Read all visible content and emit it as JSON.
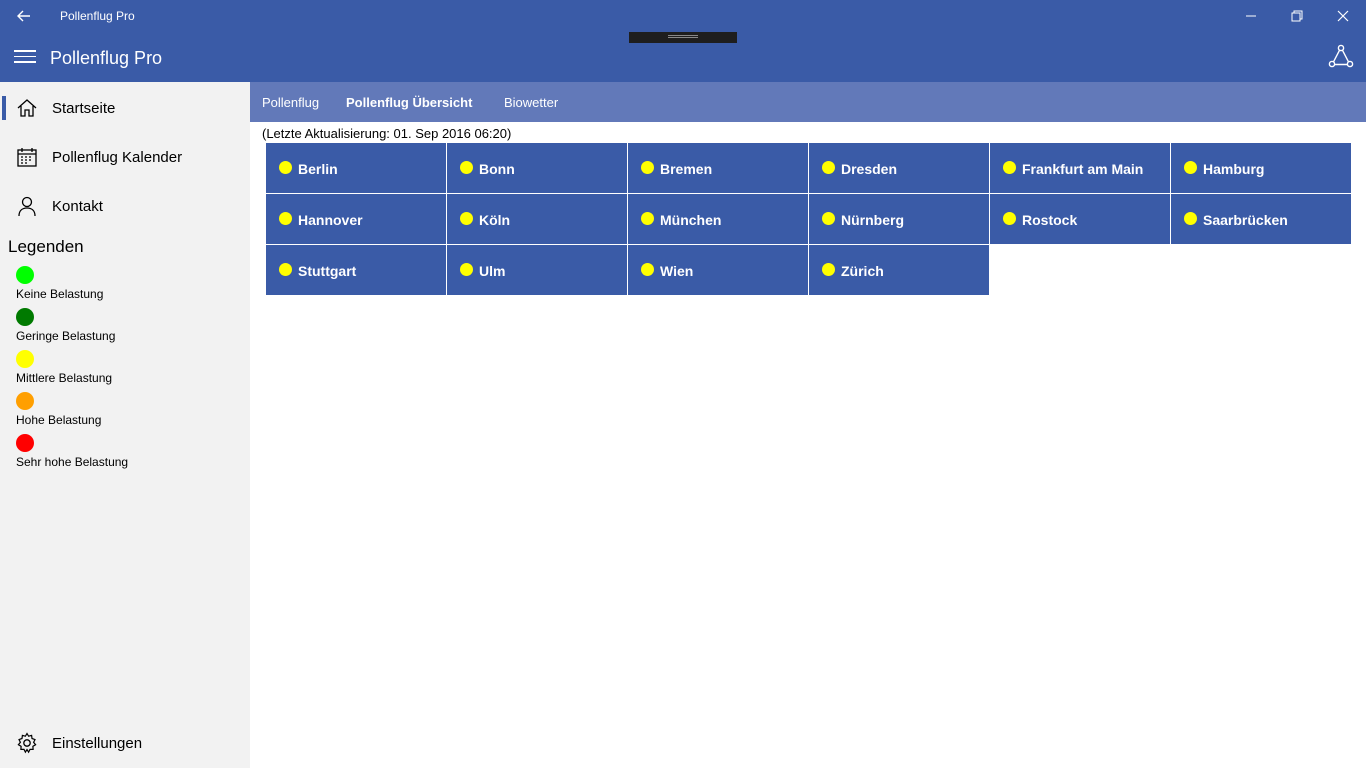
{
  "window": {
    "title": "Pollenflug Pro"
  },
  "header": {
    "title": "Pollenflug Pro"
  },
  "sidebar": {
    "items": [
      {
        "label": "Startseite",
        "icon": "home-icon",
        "active": true
      },
      {
        "label": "Pollenflug Kalender",
        "icon": "calendar-icon",
        "active": false
      },
      {
        "label": "Kontakt",
        "icon": "person-icon",
        "active": false
      }
    ],
    "legend_title": "Legenden",
    "legend": [
      {
        "label": "Keine Belastung",
        "color": "#00ff00"
      },
      {
        "label": "Geringe Belastung",
        "color": "#007a00"
      },
      {
        "label": "Mittlere Belastung",
        "color": "#ffff00"
      },
      {
        "label": "Hohe Belastung",
        "color": "#ff9f00"
      },
      {
        "label": "Sehr hohe Belastung",
        "color": "#ff0000"
      }
    ],
    "settings_label": "Einstellungen"
  },
  "tabs": [
    {
      "label": "Pollenflug",
      "active": false
    },
    {
      "label": "Pollenflug Übersicht",
      "active": true
    },
    {
      "label": "Biowetter",
      "active": false
    }
  ],
  "update_text": "(Letzte Aktualisierung: 01. Sep 2016 06:20)",
  "cities": [
    {
      "name": "Berlin",
      "level_color": "#ffff00"
    },
    {
      "name": "Bonn",
      "level_color": "#ffff00"
    },
    {
      "name": "Bremen",
      "level_color": "#ffff00"
    },
    {
      "name": "Dresden",
      "level_color": "#ffff00"
    },
    {
      "name": "Frankfurt am Main",
      "level_color": "#ffff00"
    },
    {
      "name": "Hamburg",
      "level_color": "#ffff00"
    },
    {
      "name": "Hannover",
      "level_color": "#ffff00"
    },
    {
      "name": "Köln",
      "level_color": "#ffff00"
    },
    {
      "name": "München",
      "level_color": "#ffff00"
    },
    {
      "name": "Nürnberg",
      "level_color": "#ffff00"
    },
    {
      "name": "Rostock",
      "level_color": "#ffff00"
    },
    {
      "name": "Saarbrücken",
      "level_color": "#ffff00"
    },
    {
      "name": "Stuttgart",
      "level_color": "#ffff00"
    },
    {
      "name": "Ulm",
      "level_color": "#ffff00"
    },
    {
      "name": "Wien",
      "level_color": "#ffff00"
    },
    {
      "name": "Zürich",
      "level_color": "#ffff00"
    }
  ],
  "colors": {
    "accent": "#3a5ba7",
    "tabbar": "#6279b9",
    "sidebar_bg": "#f2f2f2"
  }
}
